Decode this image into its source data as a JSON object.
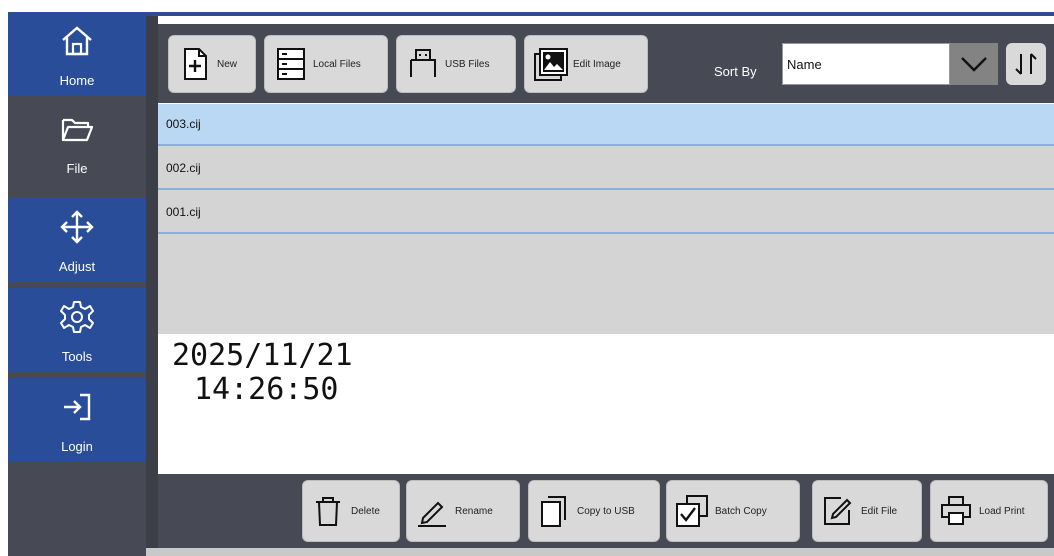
{
  "sidebar": {
    "items": [
      {
        "label": "Home",
        "icon": "home-icon"
      },
      {
        "label": "File",
        "icon": "folder-icon"
      },
      {
        "label": "Adjust",
        "icon": "move-icon"
      },
      {
        "label": "Tools",
        "icon": "gear-icon"
      },
      {
        "label": "Login",
        "icon": "login-icon"
      }
    ],
    "active": "File"
  },
  "toolbar": {
    "new_label": "New",
    "local_files_label": "Local Files",
    "usb_files_label": "USB Files",
    "edit_image_label": "Edit Image",
    "sort_by_label": "Sort By",
    "sort_value": "Name"
  },
  "files": [
    {
      "name": "003.cij",
      "selected": true
    },
    {
      "name": "002.cij",
      "selected": false
    },
    {
      "name": "001.cij",
      "selected": false
    }
  ],
  "info": {
    "date": "2025/11/21",
    "time": "14:26:50"
  },
  "actions": {
    "delete_label": "Delete",
    "rename_label": "Rename",
    "copy_to_usb_label": "Copy to USB",
    "batch_copy_label": "Batch Copy",
    "edit_file_label": "Edit File",
    "load_print_label": "Load Print"
  },
  "colors": {
    "sidebar_blue": "#294d99",
    "panel_gray": "#474a54",
    "selected_row": "#bad8f3"
  }
}
